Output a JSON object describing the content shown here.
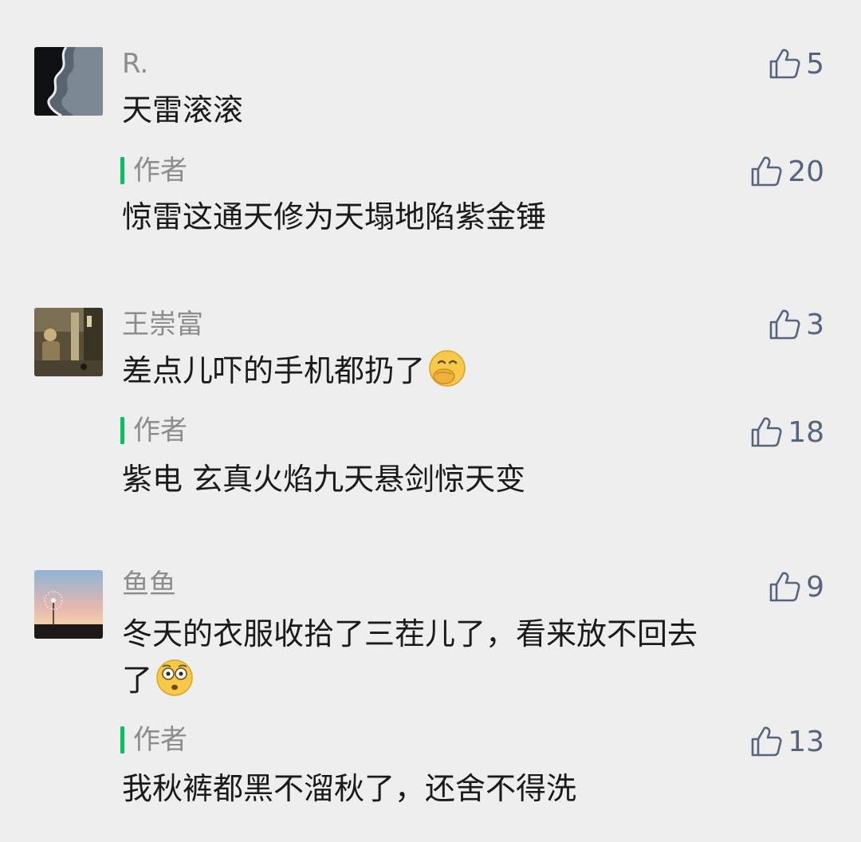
{
  "comments": [
    {
      "name": "R.",
      "likes": "5",
      "text": "天雷滚滚",
      "avatar": "ocean-shore-avatar",
      "reply": {
        "label": "作者",
        "likes": "20",
        "text": "惊雷这通天修为天塌地陷紫金锤"
      }
    },
    {
      "name": "王崇富",
      "likes": "3",
      "text": "差点儿吓的手机都扔了",
      "emoji": "hand-over-mouth-emoji",
      "avatar": "street-night-avatar",
      "reply": {
        "label": "作者",
        "likes": "18",
        "text": "紫电 玄真火焰九天悬剑惊天变"
      }
    },
    {
      "name": "鱼鱼",
      "likes": "9",
      "text_line1": "冬天的衣服收拾了三茬儿了，看来放不回去",
      "text_line2": "了",
      "emoji": "flushed-face-emoji",
      "avatar": "dandelion-sunset-avatar",
      "reply": {
        "label": "作者",
        "likes": "13",
        "text": "我秋裤都黑不溜秋了，还舍不得洗"
      }
    }
  ],
  "colors": {
    "background": "#eeeeee",
    "name_gray": "#8c8c8c",
    "like_blue": "#56657e",
    "author_green": "#07c160",
    "text": "#1a1a1a"
  }
}
